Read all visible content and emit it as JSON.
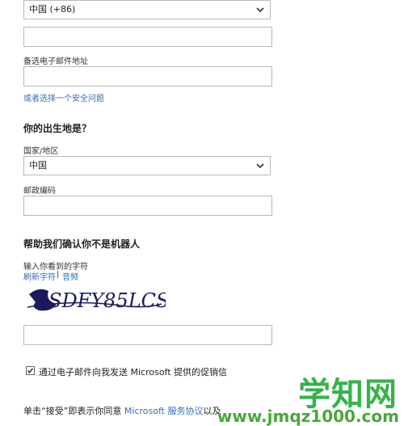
{
  "country_code_select": {
    "value": "中国 (+86)"
  },
  "alt_email": {
    "label": "备选电子邮件地址",
    "value": ""
  },
  "security_question_link": "或者选择一个安全问题",
  "birthplace": {
    "heading": "你的出生地是？",
    "country_label": "国家/地区",
    "country_value": "中国",
    "postal_label": "邮政编码"
  },
  "captcha": {
    "heading": "帮助我们确认你不是机器人",
    "prompt": "输入你看到的字符",
    "refresh_link": "刷新字符",
    "separator": "|",
    "audio_link": "音频",
    "image_text": "SDFY85LCS"
  },
  "promo_checkbox": {
    "checked": true,
    "label": "通过电子邮件向我发送 Microsoft 提供的促销信"
  },
  "terms": {
    "prefix": "单击“接受”即表示你同意 ",
    "link": "Microsoft 服务协议",
    "suffix": "以及"
  },
  "watermark": {
    "text": "学知网",
    "url": "www.jmqz1000.com"
  },
  "colors": {
    "link": "#2f6fb9",
    "watermark": "#35b34a"
  }
}
